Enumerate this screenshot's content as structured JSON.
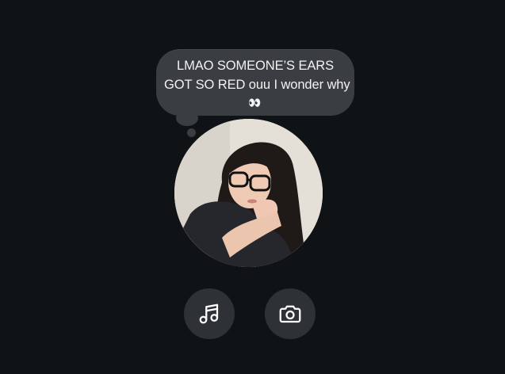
{
  "note": {
    "line1": "LMAO SOMEONE’S EARS",
    "line2": "GOT SO RED ouu I wonder why",
    "emoji": "👀"
  },
  "profile": {
    "avatar_alt": "profile photo"
  },
  "actions": [
    {
      "icon": "music-note-icon"
    },
    {
      "icon": "camera-icon"
    }
  ],
  "colors": {
    "background": "#101316",
    "bubble": "#3a3d42",
    "button": "#2e3136",
    "text": "#f2f2f2"
  }
}
